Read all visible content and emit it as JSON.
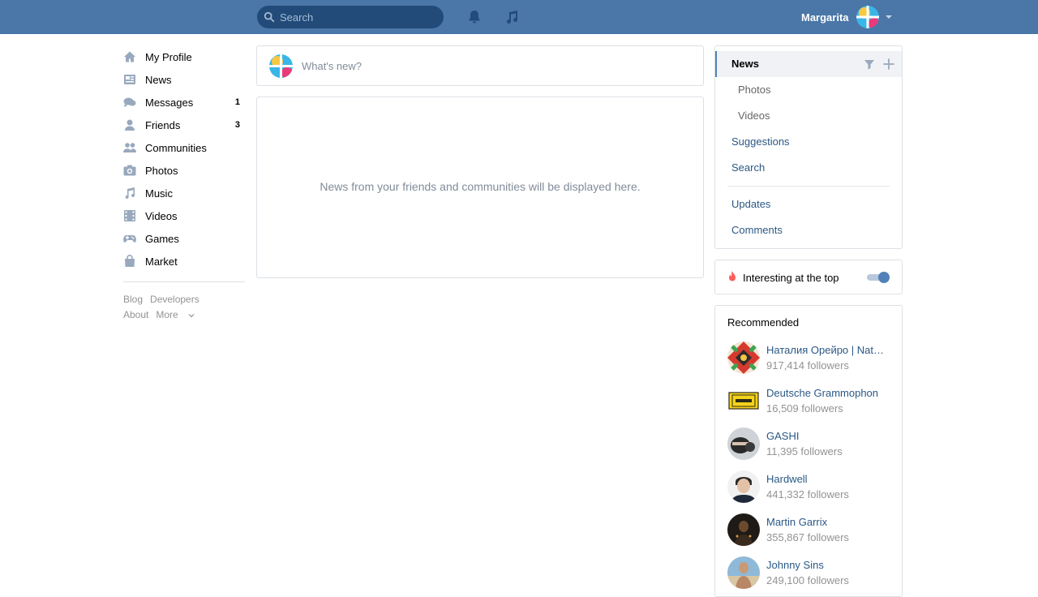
{
  "topbar": {
    "search_placeholder": "Search",
    "user_name": "Margarita"
  },
  "left_nav": {
    "items": [
      {
        "label": "My Profile",
        "icon": "home-icon",
        "count": ""
      },
      {
        "label": "News",
        "icon": "news-icon",
        "count": ""
      },
      {
        "label": "Messages",
        "icon": "messages-icon",
        "count": "1"
      },
      {
        "label": "Friends",
        "icon": "friends-icon",
        "count": "3"
      },
      {
        "label": "Communities",
        "icon": "communities-icon",
        "count": ""
      },
      {
        "label": "Photos",
        "icon": "camera-icon",
        "count": ""
      },
      {
        "label": "Music",
        "icon": "music-icon",
        "count": ""
      },
      {
        "label": "Videos",
        "icon": "film-icon",
        "count": ""
      },
      {
        "label": "Games",
        "icon": "gamepad-icon",
        "count": ""
      },
      {
        "label": "Market",
        "icon": "bag-icon",
        "count": ""
      }
    ],
    "footer": {
      "blog": "Blog",
      "developers": "Developers",
      "about": "About",
      "more": "More"
    }
  },
  "composer": {
    "placeholder": "What's new?"
  },
  "feed": {
    "empty_message": "News from your friends and communities will be displayed here."
  },
  "right_nav": {
    "news": "News",
    "photos": "Photos",
    "videos": "Videos",
    "suggestions": "Suggestions",
    "search": "Search",
    "updates": "Updates",
    "comments": "Comments"
  },
  "interesting": {
    "label": "Interesting at the top",
    "enabled": true
  },
  "recommended": {
    "title": "Recommended",
    "items": [
      {
        "name": "Наталия Орейро | Natalia Oreiro",
        "followers": "917,414 followers"
      },
      {
        "name": "Deutsche Grammophon",
        "followers": "16,509 followers"
      },
      {
        "name": "GASHI",
        "followers": "11,395 followers"
      },
      {
        "name": "Hardwell",
        "followers": "441,332 followers"
      },
      {
        "name": "Martin Garrix",
        "followers": "355,867 followers"
      },
      {
        "name": "Johnny Sins",
        "followers": "249,100 followers"
      }
    ]
  },
  "colors": {
    "header": "#4a76a8",
    "link": "#2a5885",
    "accent": "#5181b8",
    "muted": "#939393"
  }
}
